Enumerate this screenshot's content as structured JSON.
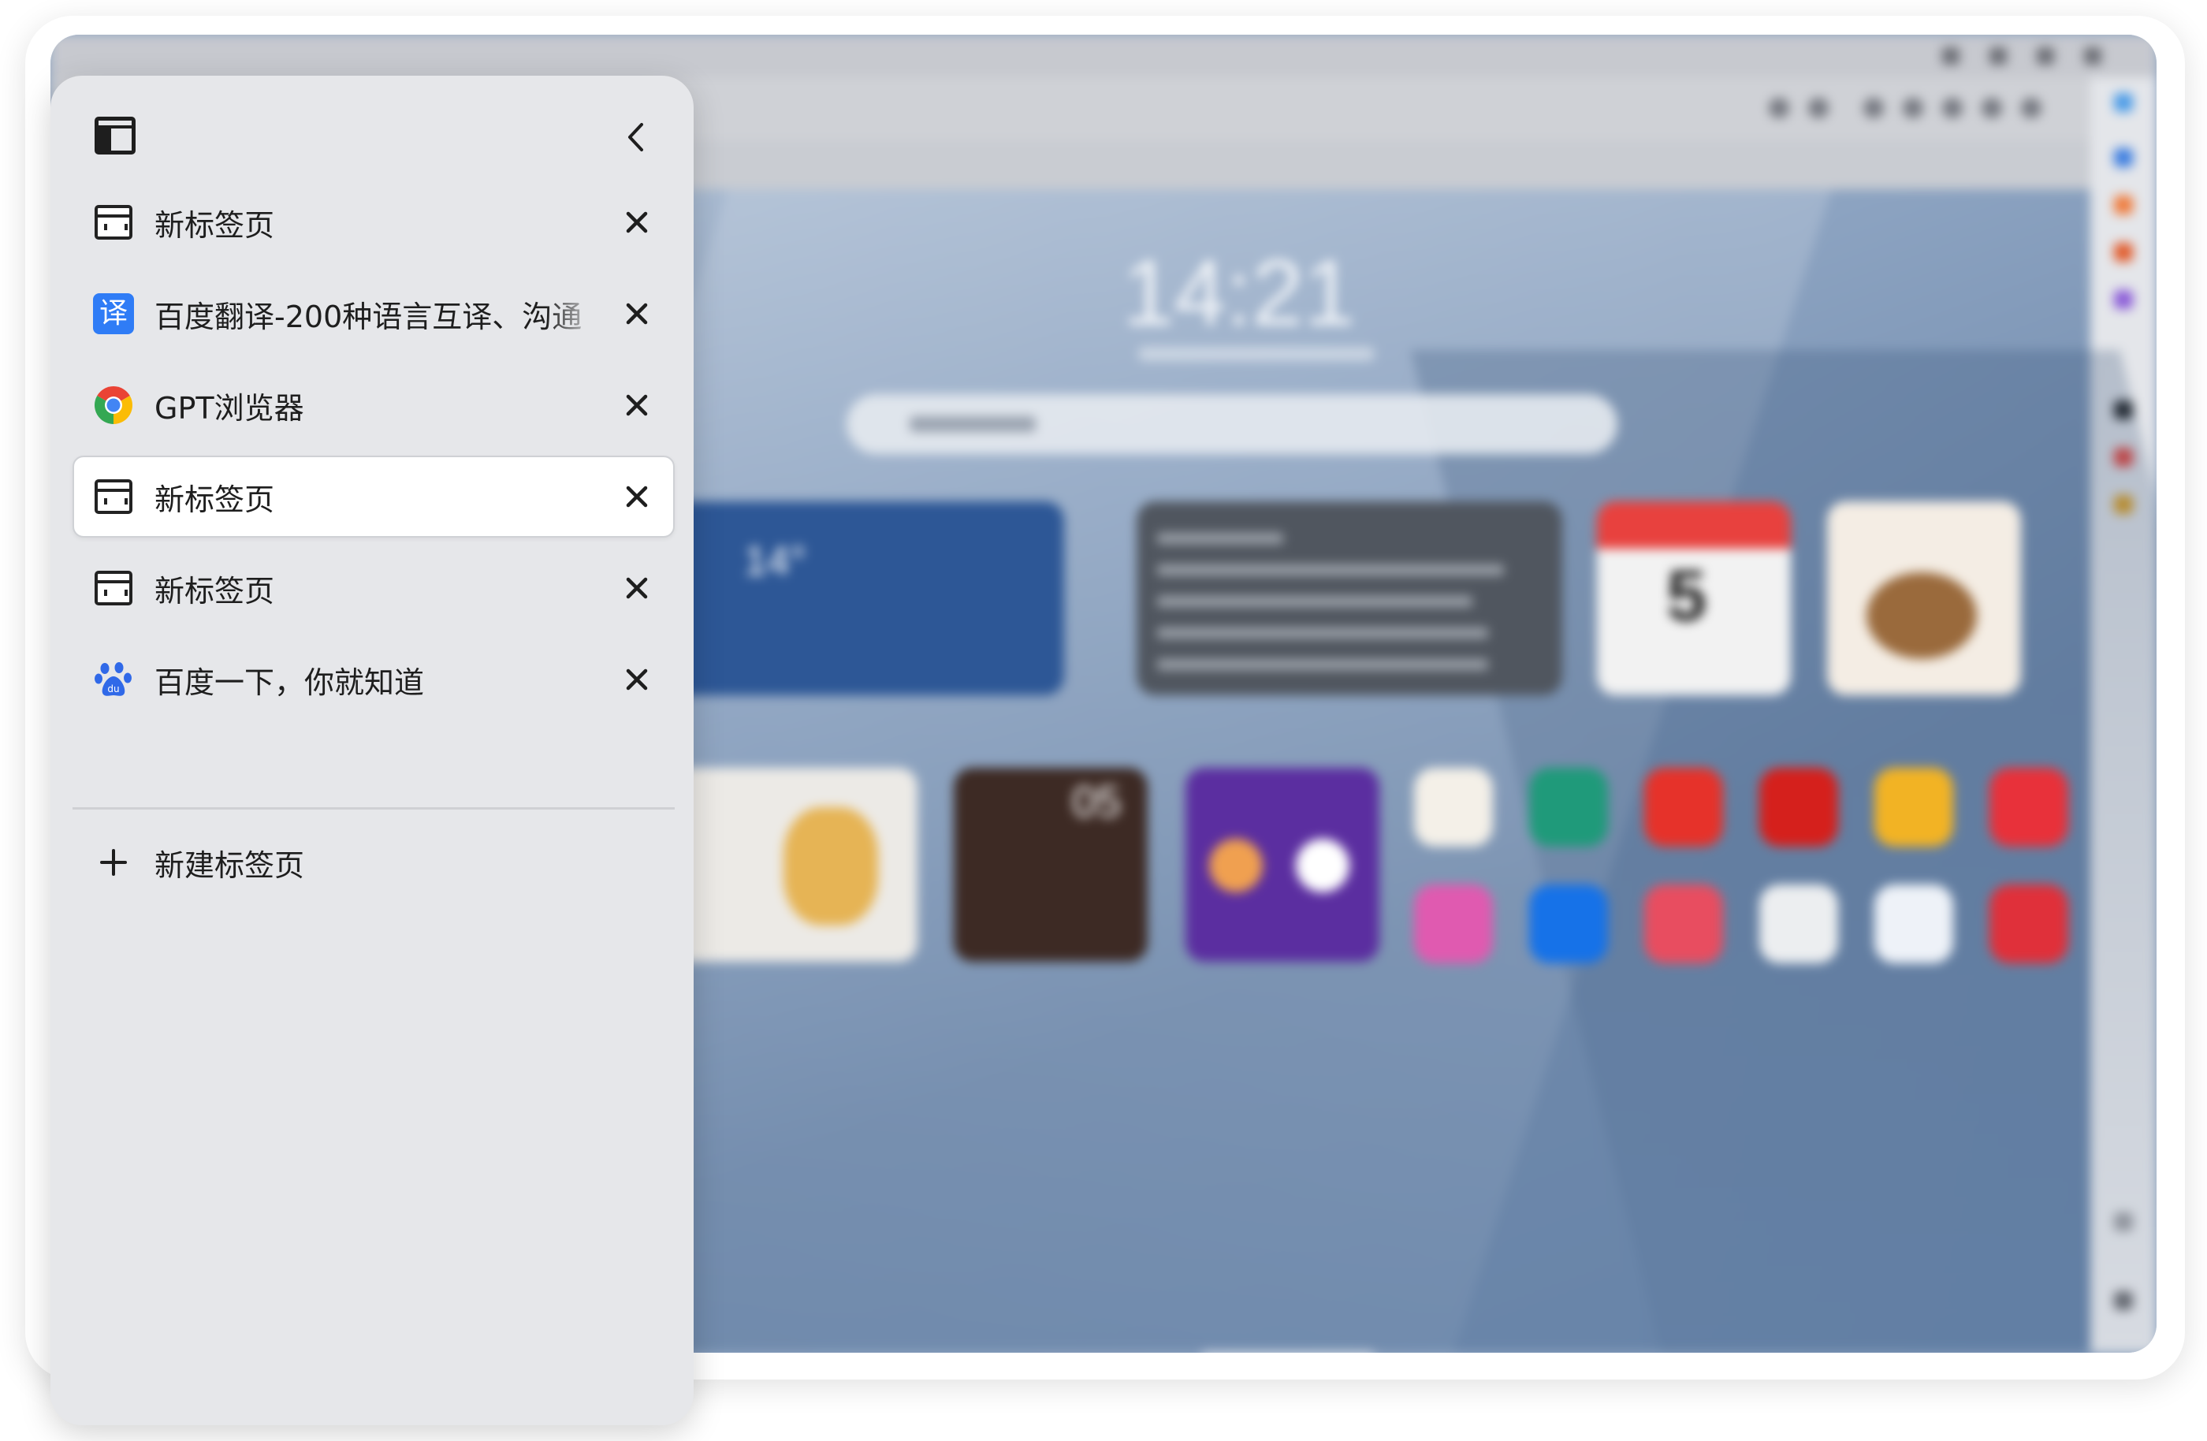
{
  "panel": {
    "tabs": [
      {
        "title": "新标签页",
        "icon": "new-tab-icon",
        "active": false
      },
      {
        "title": "百度翻译-200种语言互译、沟通",
        "icon": "translate-icon",
        "icon_glyph": "译",
        "active": false
      },
      {
        "title": "GPT浏览器",
        "icon": "chrome-icon",
        "active": false
      },
      {
        "title": "新标签页",
        "icon": "new-tab-icon",
        "active": true
      },
      {
        "title": "新标签页",
        "icon": "new-tab-icon",
        "active": false
      },
      {
        "title": "百度一下，你就知道",
        "icon": "baidu-paw-icon",
        "active": false
      }
    ],
    "new_tab_label": "新建标签页"
  },
  "background": {
    "clock": "14:21",
    "weather_temp": "14°",
    "calendar_day": "5",
    "video_number": "05"
  },
  "colors": {
    "panel_bg": "#e6e7ea",
    "active_tab_bg": "#ffffff",
    "translate_blue": "#2f7cf6",
    "text": "#1e1e1e"
  }
}
